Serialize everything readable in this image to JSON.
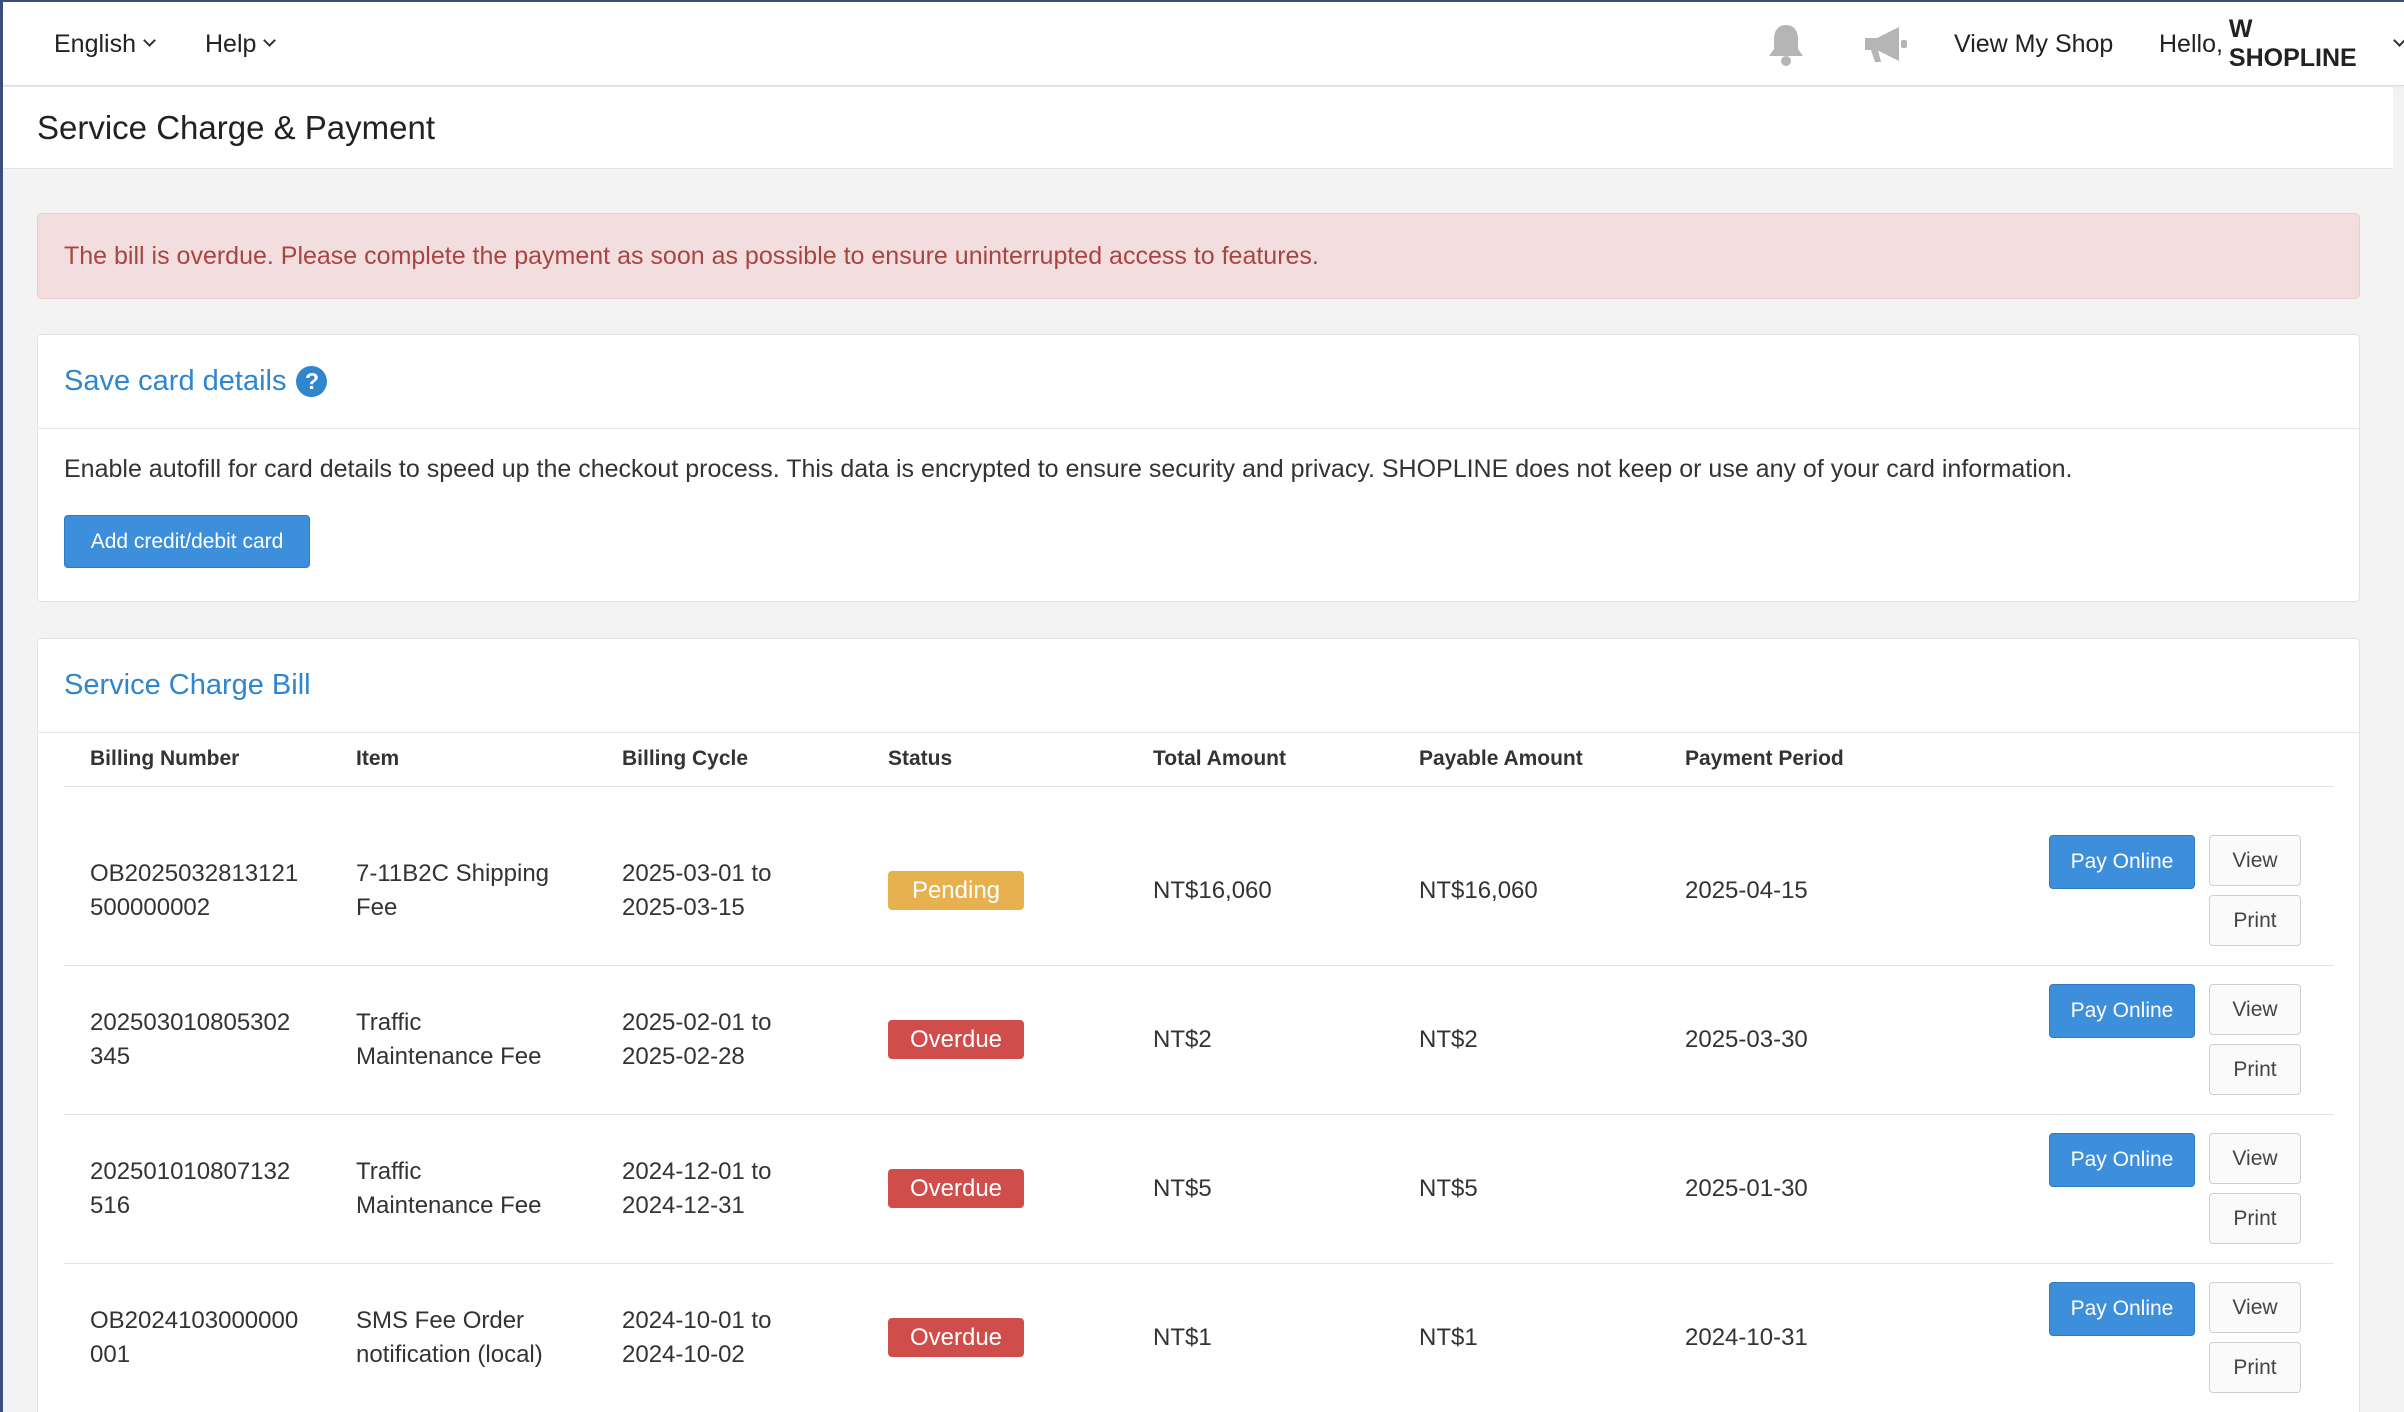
{
  "topbar": {
    "language": "English",
    "help": "Help",
    "bell_icon": "bell-icon",
    "announcement_icon": "megaphone-icon",
    "view_shop": "View My Shop",
    "greeting": "Hello,",
    "user_name": "W SHOPLINE"
  },
  "page": {
    "title": "Service Charge & Payment"
  },
  "alert": {
    "message": "The bill is overdue. Please complete the payment as soon as possible to ensure uninterrupted access to features."
  },
  "card_panel": {
    "title": "Save card details",
    "help_glyph": "?",
    "description": "Enable autofill for card details to speed up the checkout process. This data is encrypted to ensure security and privacy. SHOPLINE does not keep or use any of your card information.",
    "add_button": "Add credit/debit card"
  },
  "bill_panel": {
    "title": "Service Charge Bill",
    "columns": [
      "Billing Number",
      "Item",
      "Billing Cycle",
      "Status",
      "Total Amount",
      "Payable Amount",
      "Payment Period"
    ],
    "rows": [
      {
        "billing_number": [
          "OB2025032813121",
          "500000002"
        ],
        "item": [
          "7-11B2C Shipping",
          "Fee"
        ],
        "cycle": [
          "2025-03-01 to",
          "2025-03-15"
        ],
        "status": "Pending",
        "total": "NT$16,060",
        "payable": "NT$16,060",
        "period": "2025-04-15"
      },
      {
        "billing_number": [
          "202503010805302",
          "345"
        ],
        "item": [
          "Traffic",
          "Maintenance Fee"
        ],
        "cycle": [
          "2025-02-01 to",
          "2025-02-28"
        ],
        "status": "Overdue",
        "total": "NT$2",
        "payable": "NT$2",
        "period": "2025-03-30"
      },
      {
        "billing_number": [
          "202501010807132",
          "516"
        ],
        "item": [
          "Traffic",
          "Maintenance Fee"
        ],
        "cycle": [
          "2024-12-01 to",
          "2024-12-31"
        ],
        "status": "Overdue",
        "total": "NT$5",
        "payable": "NT$5",
        "period": "2025-01-30"
      },
      {
        "billing_number": [
          "OB2024103000000",
          "001"
        ],
        "item": [
          "SMS Fee Order",
          "notification (local)"
        ],
        "cycle": [
          "2024-10-01 to",
          "2024-10-02"
        ],
        "status": "Overdue",
        "total": "NT$1",
        "payable": "NT$1",
        "period": "2024-10-31"
      }
    ],
    "pay_label": "Pay Online",
    "view_label": "View",
    "print_label": "Print"
  },
  "colors": {
    "link_blue": "#2f86cf",
    "primary_button": "#3d8fdc",
    "alert_text": "#a94442",
    "alert_bg": "#f2dede",
    "pending": "#e8b14f",
    "overdue": "#cf4e4b"
  }
}
